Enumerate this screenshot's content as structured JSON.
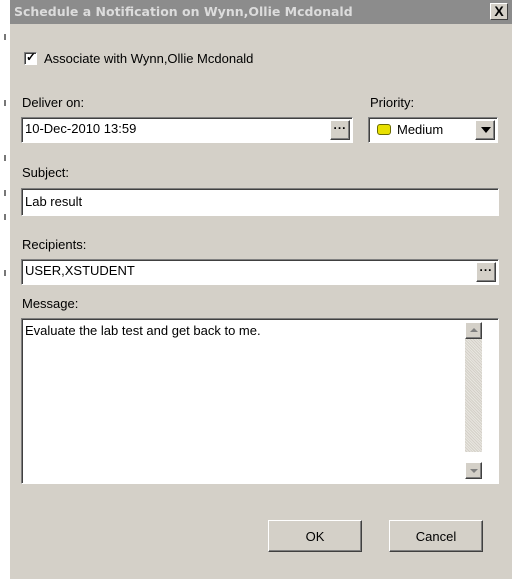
{
  "dialog": {
    "title": "Schedule a Notification on Wynn,Ollie Mcdonald",
    "close_label": "X"
  },
  "associate": {
    "label": "Associate with Wynn,Ollie Mcdonald",
    "checked": true
  },
  "deliver": {
    "label": "Deliver on:",
    "value": "10-Dec-2010 13:59",
    "picker_label": "..."
  },
  "priority": {
    "label": "Priority:",
    "value": "Medium",
    "color": "#e8e000"
  },
  "subject": {
    "label": "Subject:",
    "value": "Lab result"
  },
  "recipients": {
    "label": "Recipients:",
    "value": "USER,XSTUDENT",
    "picker_label": "..."
  },
  "message": {
    "label": "Message:",
    "value": "Evaluate the lab test and get back to me."
  },
  "buttons": {
    "ok": "OK",
    "cancel": "Cancel"
  }
}
